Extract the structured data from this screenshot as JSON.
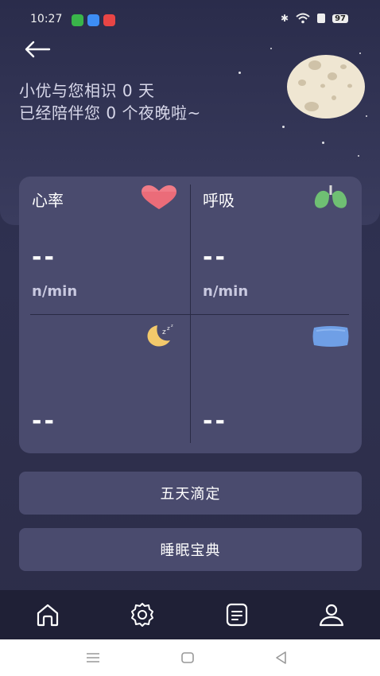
{
  "status_bar": {
    "time": "10:27",
    "battery": "97"
  },
  "header": {
    "line1": "小优与您相识 0 天",
    "line2": "已经陪伴您 0 个夜晚啦~"
  },
  "metrics": {
    "heart_rate": {
      "title": "心率",
      "value": "--",
      "unit": "n/min",
      "icon": "heart-icon"
    },
    "breathing": {
      "title": "呼吸",
      "value": "--",
      "unit": "n/min",
      "icon": "lungs-icon"
    },
    "sleep": {
      "value": "--",
      "icon": "moon-sleep-icon"
    },
    "pillow": {
      "value": "--",
      "icon": "pillow-icon"
    }
  },
  "buttons": {
    "titration": "五天滴定",
    "sleep_guide": "睡眠宝典"
  },
  "tabs": [
    {
      "icon": "home-icon"
    },
    {
      "icon": "settings-icon"
    },
    {
      "icon": "report-icon"
    },
    {
      "icon": "profile-icon"
    }
  ],
  "colors": {
    "background": "#2c2d48",
    "card": "#4a4b6e",
    "tabbar": "#1f2036",
    "heart": "#f07b87",
    "lungs": "#6fbf73",
    "pillow": "#6f9fe6",
    "moon": "#f3c96b"
  }
}
